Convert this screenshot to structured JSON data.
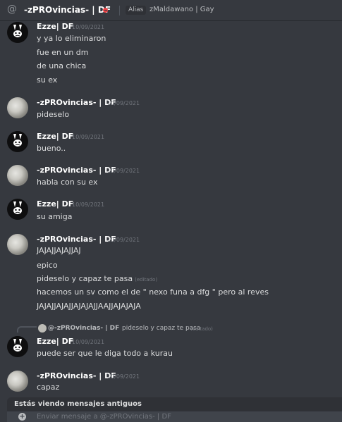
{
  "header": {
    "at_symbol": "@",
    "channel_name": "-zPROvincias- | DF",
    "alias_label": "Alias",
    "nickname": "zMaldawano | Gay"
  },
  "messages": [
    {
      "author": "Ezze| DF",
      "timestamp": "10/09/2021",
      "lines": [
        "y ya lo eliminaron",
        "fue en un dm",
        "de una chica",
        "su ex"
      ]
    },
    {
      "author": "-zPROvincias- | DF",
      "timestamp": "10/09/2021",
      "lines": [
        "pideselo"
      ]
    },
    {
      "author": "Ezze| DF",
      "timestamp": "10/09/2021",
      "lines": [
        "bueno.."
      ]
    },
    {
      "author": "-zPROvincias- | DF",
      "timestamp": "10/09/2021",
      "lines": [
        "habla con su ex"
      ]
    },
    {
      "author": "Ezze| DF",
      "timestamp": "10/09/2021",
      "lines": [
        "su amiga"
      ]
    },
    {
      "author": "-zPROvincias- | DF",
      "timestamp": "10/09/2021",
      "lines": [
        "JAJAJJAJAJJAJ",
        "epico",
        "pideselo y capaz te pasa",
        "hacemos un sv como el de \" nexo funa a dfg \" pero al reves",
        "JAJAJJAJAJJAJAJAJJAAJJAJAJAJA"
      ],
      "edited_label": "(editado)"
    },
    {
      "author": "Ezze| DF",
      "timestamp": "10/09/2021",
      "lines": [
        "puede ser que le diga todo a kurau"
      ]
    },
    {
      "author": "-zPROvincias- | DF",
      "timestamp": "10/09/2021",
      "lines": [
        "capaz"
      ]
    }
  ],
  "reply": {
    "author": "@-zPROvincias- | DF",
    "text": "pideselo y capaz te pasa",
    "edited_label": "(editado)"
  },
  "banner": {
    "text": "Estás viendo mensajes antiguos"
  },
  "composer": {
    "placeholder": "Enviar mensaje a @-zPROvincias- | DF"
  }
}
